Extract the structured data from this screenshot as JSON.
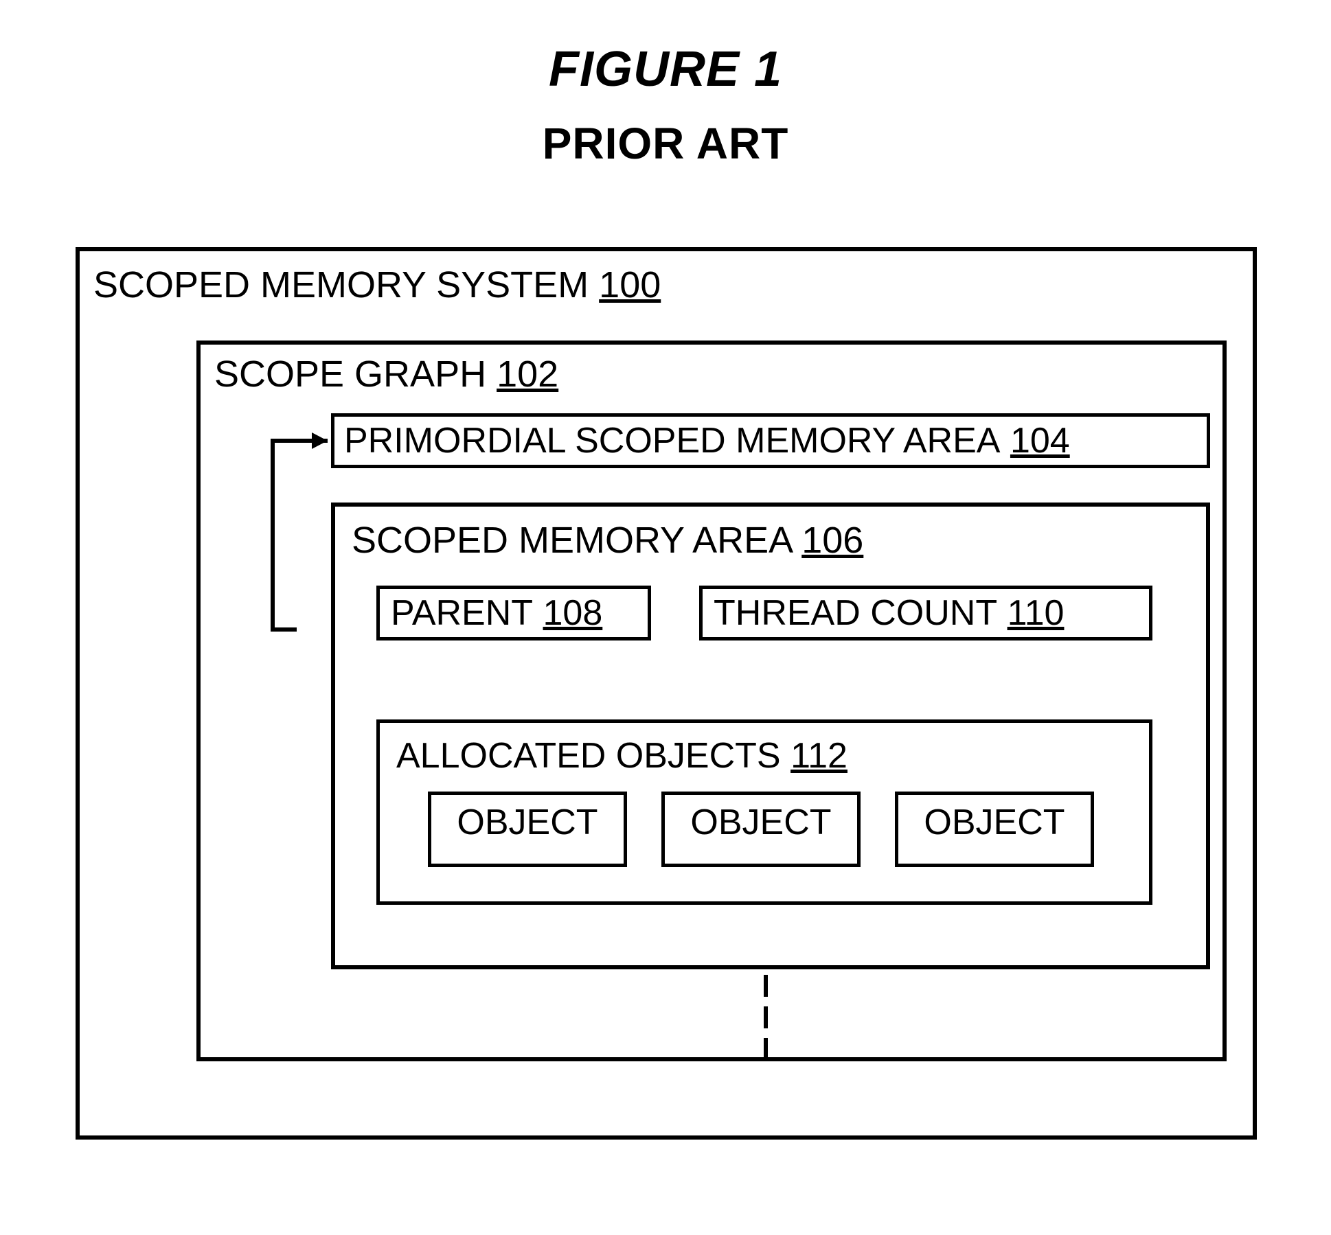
{
  "title": {
    "line1": "FIGURE 1",
    "line2": "PRIOR ART"
  },
  "outer": {
    "label": "SCOPED MEMORY SYSTEM ",
    "ref": "100"
  },
  "scopeGraph": {
    "label": "SCOPE GRAPH ",
    "ref": "102"
  },
  "primordial": {
    "label": "PRIMORDIAL SCOPED MEMORY AREA ",
    "ref": "104"
  },
  "scopedMemArea": {
    "label": "SCOPED MEMORY AREA ",
    "ref": "106"
  },
  "parent": {
    "label": "PARENT ",
    "ref": "108"
  },
  "threadCount": {
    "label": "THREAD COUNT ",
    "ref": "110"
  },
  "allocated": {
    "label": "ALLOCATED OBJECTS ",
    "ref": "112",
    "objects": [
      "OBJECT",
      "OBJECT",
      "OBJECT"
    ]
  }
}
